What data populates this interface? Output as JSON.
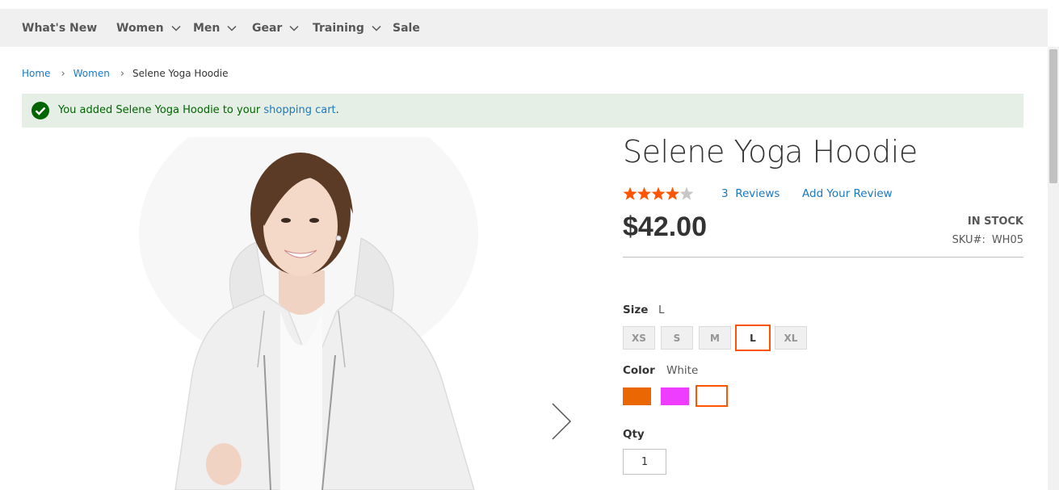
{
  "nav": {
    "items": [
      {
        "label": "What's New",
        "has_dropdown": false
      },
      {
        "label": "Women",
        "has_dropdown": true
      },
      {
        "label": "Men",
        "has_dropdown": true
      },
      {
        "label": "Gear",
        "has_dropdown": true
      },
      {
        "label": "Training",
        "has_dropdown": true
      },
      {
        "label": "Sale",
        "has_dropdown": false
      }
    ]
  },
  "breadcrumb": {
    "home": "Home",
    "category": "Women",
    "current": "Selene Yoga Hoodie"
  },
  "message": {
    "text_before": "You added Selene Yoga Hoodie to your ",
    "link": "shopping cart",
    "text_after": ".",
    "icon": "checkmark-circle-icon"
  },
  "product": {
    "name": "Selene Yoga Hoodie",
    "rating_stars": 4,
    "rating_max": 5,
    "reviews_count": "3",
    "reviews_label": "Reviews",
    "add_review": "Add Your Review",
    "price": "$42.00",
    "stock": "IN STOCK",
    "sku_label": "SKU#:",
    "sku": "WH05"
  },
  "options": {
    "size": {
      "label": "Size",
      "selected": "L",
      "values": [
        "XS",
        "S",
        "M",
        "L",
        "XL"
      ]
    },
    "color": {
      "label": "Color",
      "selected": "White",
      "swatches": [
        {
          "name": "Orange",
          "hex": "#eb6703"
        },
        {
          "name": "Purple",
          "hex": "#ef3dff"
        },
        {
          "name": "White",
          "hex": "#ffffff"
        }
      ]
    },
    "qty": {
      "label": "Qty",
      "value": "1"
    }
  },
  "colors": {
    "accent": "#ff5501",
    "link": "#1979c3",
    "success_bg": "#e5efe5",
    "success_text": "#006400",
    "star": "#ff5501"
  }
}
